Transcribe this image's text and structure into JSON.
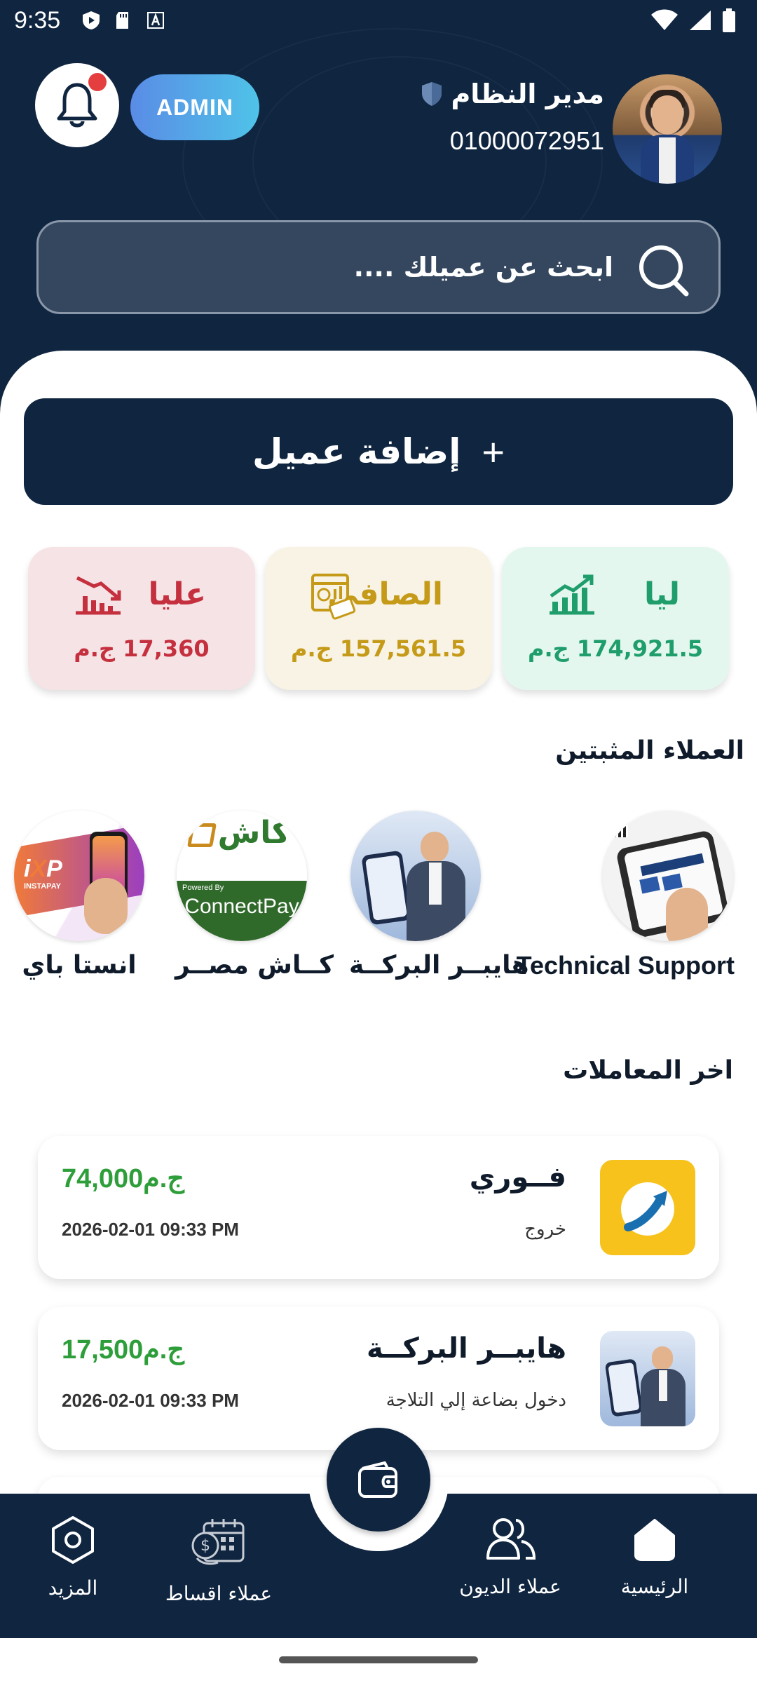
{
  "status_bar": {
    "time": "9:35"
  },
  "header": {
    "admin_badge": "ADMIN",
    "user_name": "مدير النظام",
    "user_phone": "01000072951",
    "search_placeholder": "ابحث عن عميلك ...."
  },
  "add_client": {
    "label": "إضافة عميل",
    "icon": "+"
  },
  "stats": [
    {
      "title": "ليا",
      "value": "174,921.5 ج.م",
      "color": "#1f9e6c"
    },
    {
      "title": "الصافي",
      "value": "157,561.5 ج.م",
      "color": "#c59a18"
    },
    {
      "title": "عليا",
      "value": "17,360 ج.م",
      "color": "#c5303f"
    }
  ],
  "pinned_section": {
    "title": "العملاء المثبتين",
    "items": [
      {
        "name": "Technical Support"
      },
      {
        "name": "هايبــر البركــة"
      },
      {
        "name": "كــاش مصــر",
        "logo_text": "كاش",
        "logo_sub_small": "Powered By",
        "logo_sub": "ConnectPay"
      },
      {
        "name": "انستا باي",
        "logo_text": "INSTAPAY"
      }
    ]
  },
  "transactions_section": {
    "title": "اخر المعاملات",
    "items": [
      {
        "name": "فــوري",
        "type": "خروج",
        "amount": "74,000ج.م",
        "date": "2026-02-01 09:33 PM"
      },
      {
        "name": "هايبــر البركــة",
        "type": "دخول بضاعة إلي التلاجة",
        "amount": "17,500ج.م",
        "date": "2026-02-01 09:33 PM"
      }
    ]
  },
  "bottom_nav": {
    "home": "الرئيسية",
    "debt_clients": "عملاء الديون",
    "installment_clients": "عملاء اقساط",
    "more": "المزيد"
  }
}
